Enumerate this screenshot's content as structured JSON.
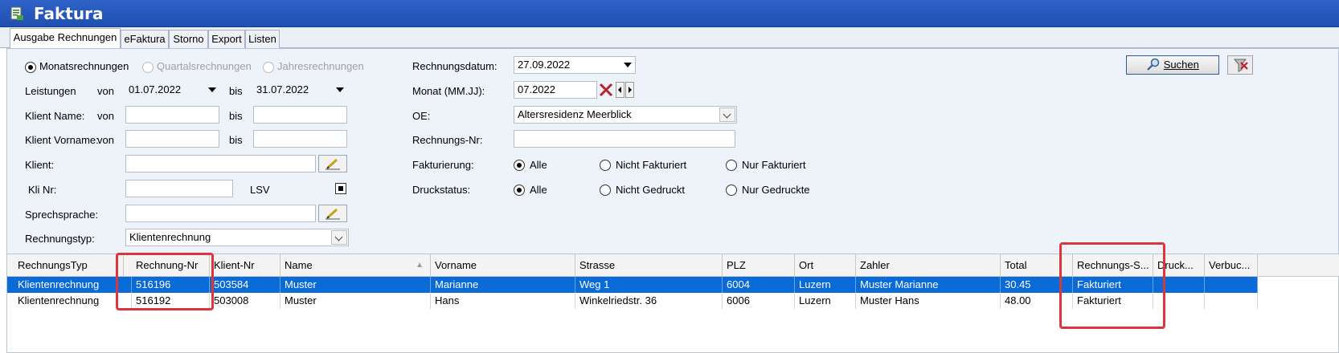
{
  "window": {
    "title": "Faktura"
  },
  "tabs": [
    "Ausgabe Rechnungen",
    "eFaktura",
    "Storno",
    "Export",
    "Listen"
  ],
  "filters": {
    "period_options": [
      "Monatsrechnungen",
      "Quartalsrechnungen",
      "Jahresrechnungen"
    ],
    "leistungen_label": "Leistungen",
    "von": "von",
    "bis": "bis",
    "leistungen_von": "01.07.2022",
    "leistungen_bis": "31.07.2022",
    "klient_name_label": "Klient Name:",
    "klient_vorname_label": "Klient Vorname:",
    "klient_label": "Klient:",
    "kli_nr_label": "Kli Nr:",
    "lsv_label": "LSV",
    "sprechsprache_label": "Sprechsprache:",
    "rechnungstyp_label": "Rechnungstyp:",
    "rechnungstyp_value": "Klientenrechnung",
    "rechnungsdatum_label": "Rechnungsdatum:",
    "rechnungsdatum_value": "27.09.2022",
    "monat_label": "Monat (MM.JJ):",
    "monat_value": "07.2022",
    "oe_label": "OE:",
    "oe_value": "Altersresidenz Meerblick",
    "rechnungs_nr_label": "Rechnungs-Nr:",
    "fakturierung_label": "Fakturierung:",
    "fakturierung_options": [
      "Alle",
      "Nicht Fakturiert",
      "Nur Fakturiert"
    ],
    "druckstatus_label": "Druckstatus:",
    "druckstatus_options": [
      "Alle",
      "Nicht Gedruckt",
      "Nur Gedruckte"
    ],
    "search_button": "Suchen"
  },
  "grid": {
    "columns": [
      "RechnungsTyp",
      "Rechnung-Nr",
      "Klient-Nr",
      "Name",
      "Vorname",
      "Strasse",
      "PLZ",
      "Ort",
      "Zahler",
      "Total",
      "Rechnungs-S...",
      "Druck...",
      "Verbuc..."
    ],
    "rows": [
      [
        "Klientenrechnung",
        "516196",
        "503584",
        "Muster",
        "Marianne",
        "Weg 1",
        "6004",
        "Luzern",
        "Muster Marianne",
        "30.45",
        "Fakturiert",
        "",
        ""
      ],
      [
        "Klientenrechnung",
        "516192",
        "503008",
        "Muster",
        "Hans",
        "Winkelriedstr. 36",
        "6006",
        "Luzern",
        "Muster Hans",
        "48.00",
        "Fakturiert",
        "",
        ""
      ]
    ]
  },
  "colors": {
    "titlebar": "#2a5cc2",
    "selection": "#0a6ad6",
    "highlight": "#d9363e"
  }
}
